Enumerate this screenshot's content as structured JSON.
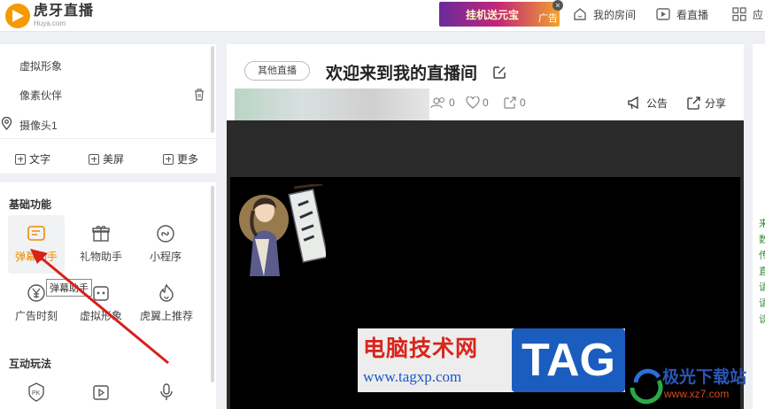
{
  "header": {
    "logo_cn": "虎牙直播",
    "logo_en": "Huya.com",
    "ad_text": "挂机送元宝",
    "ad_tag": "广告",
    "ad_close": "×",
    "nav": [
      {
        "label": "我的房间",
        "icon": "house-icon"
      },
      {
        "label": "看直播",
        "icon": "play-icon"
      },
      {
        "label": "应",
        "icon": "grid-icon"
      }
    ]
  },
  "sidebar_top": {
    "items": [
      "虚拟形象",
      "像素伙伴",
      "摄像头1"
    ],
    "quick_actions": [
      "文字",
      "美屏",
      "更多"
    ]
  },
  "sidebar_bottom": {
    "section_basic": "基础功能",
    "features": [
      {
        "label": "弹幕助手",
        "icon": "danmaku-icon",
        "active": true
      },
      {
        "label": "礼物助手",
        "icon": "gift-icon"
      },
      {
        "label": "小程序",
        "icon": "mini-program-icon"
      },
      {
        "label": "广告时刻",
        "icon": "ad-coin-icon"
      },
      {
        "label": "虚拟形象",
        "icon": "avatar-icon"
      },
      {
        "label": "虎翼上推荐",
        "icon": "flame-icon"
      }
    ],
    "tooltip": "弹幕助手",
    "section_interactive": "互动玩法"
  },
  "room": {
    "category": "其他直播",
    "title": "欢迎来到我的直播间",
    "stats": [
      "0",
      "0",
      "0"
    ],
    "announcement": "公告",
    "share": "分享"
  },
  "watermark": {
    "site_cn": "电脑技术网",
    "site_url": "www.tagxp.com",
    "tag": "TAG",
    "brand_cn": "极光下载站",
    "brand_url": "www.xz7.com"
  },
  "right_strip": [
    "来",
    "数",
    "传",
    "直",
    "请",
    "请",
    "谈"
  ],
  "colors": {
    "accent": "#f08c00",
    "brand_blue": "#1a5dbf",
    "watermark_red": "#d9241c",
    "arrow_red": "#d8201c"
  }
}
